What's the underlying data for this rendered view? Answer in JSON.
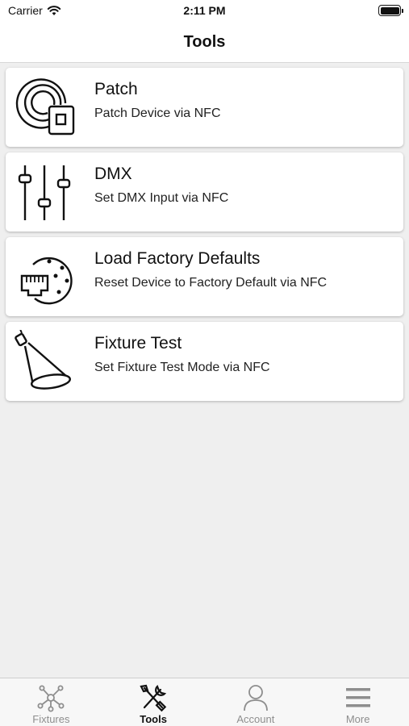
{
  "status_bar": {
    "carrier": "Carrier",
    "time": "2:11 PM"
  },
  "nav": {
    "title": "Tools"
  },
  "tools": [
    {
      "icon": "nfc-patch-icon",
      "title": "Patch",
      "subtitle": "Patch Device via NFC"
    },
    {
      "icon": "dmx-sliders-icon",
      "title": "DMX",
      "subtitle": "Set DMX Input via NFC"
    },
    {
      "icon": "factory-reset-icon",
      "title": "Load Factory Defaults",
      "subtitle": "Reset Device to Factory Default via NFC"
    },
    {
      "icon": "spotlight-icon",
      "title": "Fixture Test",
      "subtitle": "Set Fixture Test Mode via NFC"
    }
  ],
  "tab_bar": {
    "items": [
      {
        "label": "Fixtures",
        "icon": "fixtures-network-icon",
        "active": false
      },
      {
        "label": "Tools",
        "icon": "tools-icon",
        "active": true
      },
      {
        "label": "Account",
        "icon": "account-person-icon",
        "active": false
      },
      {
        "label": "More",
        "icon": "more-menu-icon",
        "active": false
      }
    ]
  },
  "colors": {
    "background": "#efefef",
    "card": "#ffffff",
    "tab_inactive": "#8e8e8e",
    "tab_active": "#111111"
  }
}
